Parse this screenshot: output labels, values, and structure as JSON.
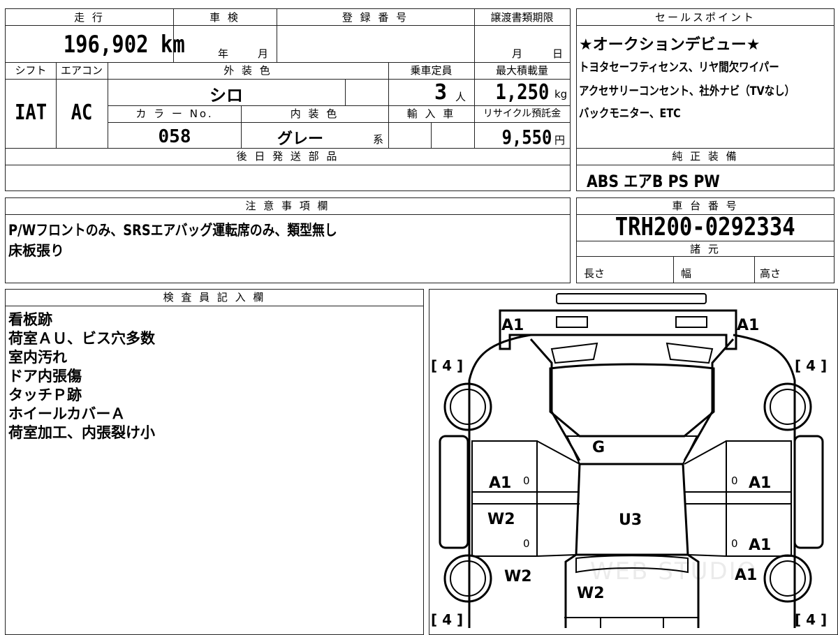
{
  "header": {
    "mileage_label": "走 行",
    "shaken_label": "車 検",
    "reg_number_label": "登 録 番 号",
    "transfer_deadline_label": "譲渡書類期限",
    "mileage_value": "196,902",
    "mileage_unit": "km",
    "shaken_year_unit": "年",
    "shaken_month_unit": "月",
    "deadline_month_unit": "月",
    "deadline_day_unit": "日",
    "shift_label": "シフト",
    "aircon_label": "エアコン",
    "exterior_color_label": "外 装 色",
    "capacity_label": "乗車定員",
    "max_load_label": "最大積載量",
    "shift_value": "IAT",
    "aircon_value": "AC",
    "exterior_color_value": "シロ",
    "capacity_value": "3",
    "capacity_unit": "人",
    "max_load_value": "1,250",
    "max_load_unit": "kg",
    "color_no_label": "カ ラ ー No.",
    "interior_color_label": "内 装 色",
    "import_label": "輸 入 車",
    "recycle_label": "リサイクル預託金",
    "color_no_value": "058",
    "interior_color_value": "グレー",
    "interior_color_suffix": "系",
    "recycle_value": "9,550",
    "recycle_unit": "円",
    "later_parts_label": "後 日 発 送 部 品"
  },
  "sales_points": {
    "label": "セールスポイント",
    "lines": [
      "★オークションデビュー★",
      "トヨタセーフティセンス、リヤ間欠ワイパー",
      "アクセサリーコンセント、社外ナビ（TVなし）",
      "バックモニター、ETC"
    ]
  },
  "genuine_equipment": {
    "label": "純 正 装 備",
    "value": "ABS エアB PS PW"
  },
  "notes": {
    "label": "注 意 事 項 欄",
    "lines": [
      "P/Wフロントのみ、SRSエアバッグ運転席のみ、類型無し",
      "床板張り"
    ]
  },
  "chassis": {
    "label": "車 台 番 号",
    "value": "TRH200-0292334"
  },
  "specs": {
    "label": "諸 元",
    "length_label": "長さ",
    "width_label": "幅",
    "height_label": "高さ"
  },
  "inspector": {
    "label": "検 査 員 記 入 欄",
    "lines": [
      "看板跡",
      "荷室ＡＵ、ビス穴多数",
      "室内汚れ",
      "ドア内張傷",
      "タッチＰ跡",
      "ホイールカバーＡ",
      "荷室加工、内張裂け小"
    ]
  },
  "diagram": {
    "marks": {
      "front_left": "A1",
      "front_right": "A1",
      "tire_fl": "[ 4 ]",
      "tire_fr": "[ 4 ]",
      "tire_rl": "[ 4 ]",
      "tire_rr": "[ 4 ]",
      "windshield": "G",
      "door_fl": "A1",
      "door_fr": "A1",
      "door_rl": "W2",
      "door_rr": "A1",
      "roof": "U3",
      "quarter_l": "W2",
      "quarter_r": "A1",
      "rear": "W2",
      "zero": "0"
    },
    "watermark": "WEB STUDIO"
  }
}
